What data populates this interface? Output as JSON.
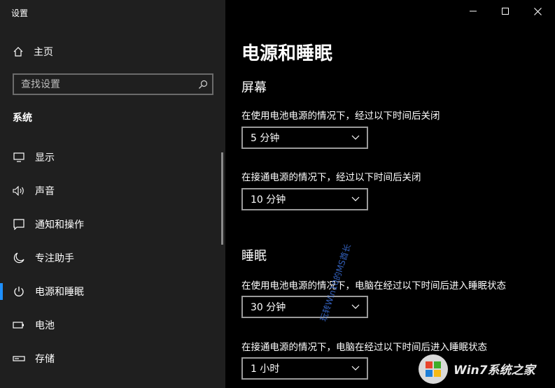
{
  "window": {
    "title": "设置"
  },
  "sidebar": {
    "home_label": "主页",
    "search_placeholder": "查找设置",
    "section_label": "系统",
    "items": [
      {
        "label": "显示",
        "icon": "monitor-icon"
      },
      {
        "label": "声音",
        "icon": "speaker-icon"
      },
      {
        "label": "通知和操作",
        "icon": "notification-icon"
      },
      {
        "label": "专注助手",
        "icon": "moon-icon"
      },
      {
        "label": "电源和睡眠",
        "icon": "power-icon",
        "active": true
      },
      {
        "label": "电池",
        "icon": "battery-icon"
      },
      {
        "label": "存储",
        "icon": "storage-icon"
      }
    ]
  },
  "main": {
    "title": "电源和睡眠",
    "screen": {
      "heading": "屏幕",
      "battery_desc": "在使用电池电源的情况下，经过以下时间后关闭",
      "battery_value": "5 分钟",
      "plugged_desc": "在接通电源的情况下，经过以下时间后关闭",
      "plugged_value": "10 分钟"
    },
    "sleep": {
      "heading": "睡眠",
      "battery_desc": "在使用电池电源的情况下，电脑在经过以下时间后进入睡眠状态",
      "battery_value": "30 分钟",
      "plugged_desc": "在接通电源的情况下，电脑在经过以下时间后进入睡眠状态",
      "plugged_value": "1 小时"
    }
  },
  "watermark": "玩转Win10的MS酋长",
  "logo": {
    "text": "Win7系统之家"
  },
  "colors": {
    "accent": "#1e90ff",
    "sidebar_bg": "#1f1f1f",
    "main_bg": "#000000"
  }
}
